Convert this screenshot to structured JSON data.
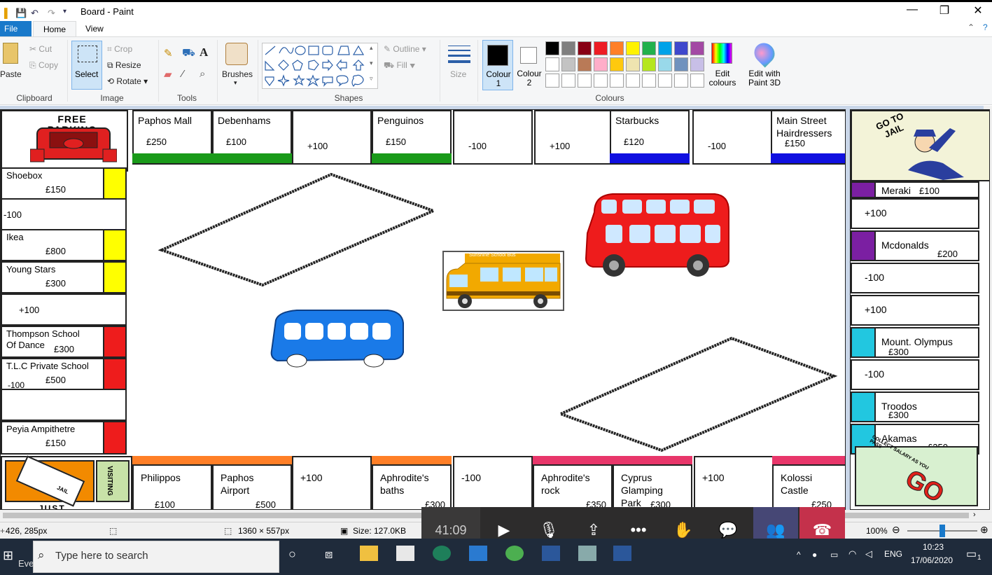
{
  "window": {
    "title": "Board - Paint",
    "minimize": "—",
    "restore": "❐",
    "close": "✕"
  },
  "menu": {
    "file": "File",
    "home": "Home",
    "view": "View"
  },
  "ribbon": {
    "clipboard": {
      "paste": "Paste",
      "cut": "Cut",
      "copy": "Copy",
      "label": "Clipboard"
    },
    "image": {
      "select": "Select",
      "crop": "Crop",
      "resize": "Resize",
      "rotate": "Rotate",
      "label": "Image"
    },
    "tools": {
      "label": "Tools"
    },
    "brushes": {
      "label": "Brushes"
    },
    "shapes": {
      "outline": "Outline",
      "fill": "Fill",
      "label": "Shapes"
    },
    "size": {
      "label": "Size"
    },
    "colours": {
      "colour1": "Colour\n1",
      "colour2": "Colour\n2",
      "edit": "Edit\ncolours",
      "paint3d": "Edit with\nPaint 3D",
      "label": "Colours",
      "palette": [
        "#000000",
        "#7f7f7f",
        "#880015",
        "#ed1c24",
        "#ff7f27",
        "#fff200",
        "#22b14c",
        "#00a2e8",
        "#3f48cc",
        "#a349a4",
        "#ffffff",
        "#c3c3c3",
        "#b97a57",
        "#ffaec9",
        "#ffc90e",
        "#efe4b0",
        "#b5e61d",
        "#99d9ea",
        "#7092be",
        "#c8bfe7"
      ]
    }
  },
  "board": {
    "free_parking": "FREE\nPARKING",
    "top": [
      {
        "name": "Paphos Mall",
        "price": "£250",
        "color": "#1a9a1a"
      },
      {
        "name": "Debenhams",
        "price": "£100",
        "color": "#1a9a1a"
      },
      {
        "name": "",
        "price": "+100",
        "color": ""
      },
      {
        "name": "Penguinos",
        "price": "£150",
        "color": "#1a9a1a"
      },
      {
        "name": "",
        "price": "-100",
        "color": ""
      },
      {
        "name": "",
        "price": "+100",
        "color": ""
      },
      {
        "name": "Starbucks",
        "price": "£120",
        "color": "#1010e0"
      },
      {
        "name": "",
        "price": "-100",
        "color": ""
      },
      {
        "name": "Main Street\nHairdressers",
        "price": "£150",
        "color": "#1010e0"
      }
    ],
    "left": [
      {
        "name": "Shoebox",
        "price": "£150",
        "color": "#ffff00"
      },
      {
        "name": "-100",
        "price": "",
        "color": ""
      },
      {
        "name": "Ikea",
        "price": "£800",
        "color": "#ffff00"
      },
      {
        "name": "Young Stars",
        "price": "£300",
        "color": "#ffff00"
      },
      {
        "name": "+100",
        "price": "",
        "color": ""
      },
      {
        "name": "Thompson School\nOf Dance",
        "price": "£300",
        "color": "#ee1c1c"
      },
      {
        "name": "T.L.C Private School",
        "price": "£500",
        "color": "#ee1c1c",
        "extra": "-100"
      },
      {
        "name": "",
        "price": "",
        "color": ""
      },
      {
        "name": "Peyia Ampithetre",
        "price": "£150",
        "color": "#ee1c1c"
      }
    ],
    "right": [
      {
        "name": "Meraki",
        "price": "£100",
        "color": "#7b1fa2"
      },
      {
        "name": "+100",
        "price": "",
        "color": ""
      },
      {
        "name": "Mcdonalds",
        "price": "£200",
        "color": "#7b1fa2"
      },
      {
        "name": "-100",
        "price": "",
        "color": ""
      },
      {
        "name": "+100",
        "price": "",
        "color": ""
      },
      {
        "name": "Mount. Olympus",
        "price": "£300",
        "color": "#22c7e0"
      },
      {
        "name": "-100",
        "price": "",
        "color": ""
      },
      {
        "name": "Troodos",
        "price": "£300",
        "color": "#22c7e0"
      },
      {
        "name": "Akamas",
        "price": "£250",
        "color": "#22c7e0"
      }
    ],
    "bottom": [
      {
        "name": "Philippos",
        "price": "£100",
        "color": "#ff7f27"
      },
      {
        "name": "Paphos\nAirport",
        "price": "£500",
        "color": "#ff7f27"
      },
      {
        "name": "+100",
        "price": "",
        "color": ""
      },
      {
        "name": "Aphrodite's\nbaths",
        "price": "£300",
        "color": "#ff7f27"
      },
      {
        "name": "-100",
        "price": "",
        "color": ""
      },
      {
        "name": "Aphrodite's\nrock",
        "price": "£350",
        "color": "#e8366a"
      },
      {
        "name": "Cyprus\nGlamping\nPark",
        "price": "£300",
        "color": "#e8366a"
      },
      {
        "name": "+100",
        "price": "",
        "color": ""
      },
      {
        "name": "Kolossi\nCastle",
        "price": "£250",
        "color": "#e8366a"
      }
    ],
    "go_to_jail": "GO TO\nJAIL",
    "jail": "JAIL",
    "visiting": "VISITING",
    "just": "JUST",
    "go_text": "GO",
    "collect": "COLLECT SALARY AS YOU PASS",
    "school_bus_sign": "Sunshine School Bus"
  },
  "status": {
    "cursor": "426, 285px",
    "selection": "",
    "dims": "1360 × 557px",
    "size": "Size: 127.0KB",
    "zoom": "100%"
  },
  "teams": {
    "timer": "41:09"
  },
  "taskbar": {
    "search_placeholder": "Type here to search",
    "user": "Evelyn Scott",
    "time": "10:23",
    "date": "17/06/2020",
    "lang": "ENG",
    "notif": "1"
  }
}
